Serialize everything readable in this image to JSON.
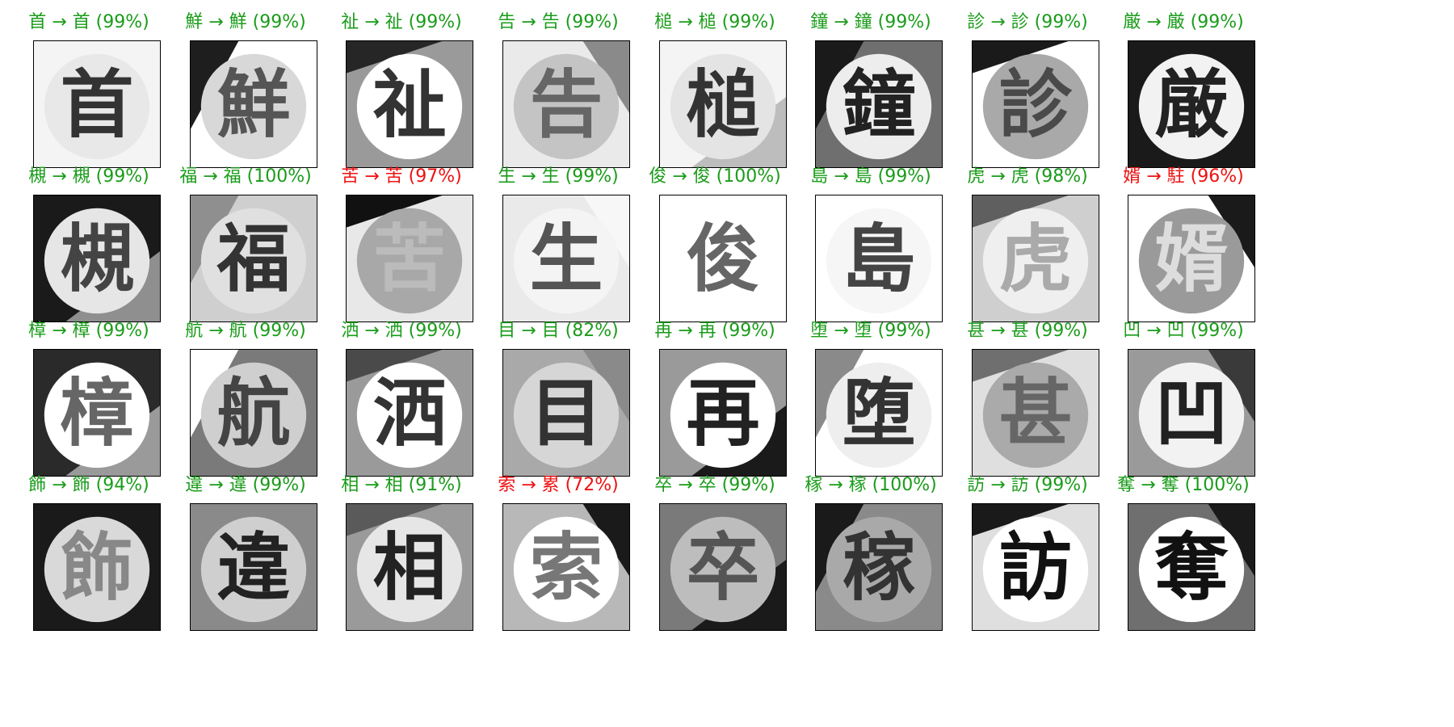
{
  "colors": {
    "correct": "#1a9c1a",
    "incorrect": "#ee1111",
    "border": "#000000"
  },
  "samples": [
    {
      "true": "首",
      "pred": "首",
      "conf": "99%",
      "correct": true,
      "shade": "#e8e8e8",
      "bg": [
        "#f4f4f4",
        "#f4f4f4"
      ],
      "ink": "#333333"
    },
    {
      "true": "鮮",
      "pred": "鮮",
      "conf": "99%",
      "correct": true,
      "shade": "#d8d8d8",
      "bg": [
        "#1e1e1e",
        "#ffffff"
      ],
      "ink": "#555555"
    },
    {
      "true": "祉",
      "pred": "祉",
      "conf": "99%",
      "correct": true,
      "shade": "#ffffff",
      "bg": [
        "#262626",
        "#9a9a9a"
      ],
      "ink": "#333333"
    },
    {
      "true": "告",
      "pred": "告",
      "conf": "99%",
      "correct": true,
      "shade": "#c4c4c4",
      "bg": [
        "#8a8a8a",
        "#eaeaea"
      ],
      "ink": "#666666"
    },
    {
      "true": "槌",
      "pred": "槌",
      "conf": "99%",
      "correct": true,
      "shade": "#e4e4e4",
      "bg": [
        "#bdbdbd",
        "#f4f4f4"
      ],
      "ink": "#333333"
    },
    {
      "true": "鐘",
      "pred": "鐘",
      "conf": "99%",
      "correct": true,
      "shade": "#ededed",
      "bg": [
        "#1a1a1a",
        "#6f6f6f"
      ],
      "ink": "#222222"
    },
    {
      "true": "診",
      "pred": "診",
      "conf": "99%",
      "correct": true,
      "shade": "#a9a9a9",
      "bg": [
        "#1a1a1a",
        "#ffffff"
      ],
      "ink": "#4a4a4a"
    },
    {
      "true": "厳",
      "pred": "厳",
      "conf": "99%",
      "correct": true,
      "shade": "#f2f2f2",
      "bg": [
        "#1a1a1a",
        "#1a1a1a"
      ],
      "ink": "#222222"
    },
    {
      "true": "槻",
      "pred": "槻",
      "conf": "99%",
      "correct": true,
      "shade": "#e6e6e6",
      "bg": [
        "#8f8f8f",
        "#1a1a1a"
      ],
      "ink": "#444444"
    },
    {
      "true": "福",
      "pred": "福",
      "conf": "100%",
      "correct": true,
      "shade": "#e0e0e0",
      "bg": [
        "#8f8f8f",
        "#cfcfcf"
      ],
      "ink": "#333333"
    },
    {
      "true": "苦",
      "pred": "苦",
      "conf": "97%",
      "correct": false,
      "shade": "#a8a8a8",
      "bg": [
        "#111111",
        "#e8e8e8"
      ],
      "ink": "#bbbbbb"
    },
    {
      "true": "生",
      "pred": "生",
      "conf": "99%",
      "correct": true,
      "shade": "#f4f4f4",
      "bg": [
        "#f7f7f7",
        "#eaeaea"
      ],
      "ink": "#555555"
    },
    {
      "true": "俊",
      "pred": "俊",
      "conf": "100%",
      "correct": true,
      "shade": "#ffffff",
      "bg": [
        "#ffffff",
        "#ffffff"
      ],
      "ink": "#666666"
    },
    {
      "true": "島",
      "pred": "島",
      "conf": "99%",
      "correct": true,
      "shade": "#f6f6f6",
      "bg": [
        "#ffffff",
        "#ffffff"
      ],
      "ink": "#444444"
    },
    {
      "true": "虎",
      "pred": "虎",
      "conf": "98%",
      "correct": true,
      "shade": "#efefef",
      "bg": [
        "#5f5f5f",
        "#cfcfcf"
      ],
      "ink": "#aaaaaa"
    },
    {
      "true": "婿",
      "pred": "駐",
      "conf": "96%",
      "correct": false,
      "shade": "#9a9a9a",
      "bg": [
        "#1a1a1a",
        "#ffffff"
      ],
      "ink": "#dddddd"
    },
    {
      "true": "樟",
      "pred": "樟",
      "conf": "99%",
      "correct": true,
      "shade": "#ffffff",
      "bg": [
        "#9a9a9a",
        "#2a2a2a"
      ],
      "ink": "#666666"
    },
    {
      "true": "航",
      "pred": "航",
      "conf": "99%",
      "correct": true,
      "shade": "#cfcfcf",
      "bg": [
        "#ffffff",
        "#7a7a7a"
      ],
      "ink": "#444444"
    },
    {
      "true": "洒",
      "pred": "洒",
      "conf": "99%",
      "correct": true,
      "shade": "#ffffff",
      "bg": [
        "#4a4a4a",
        "#9a9a9a"
      ],
      "ink": "#333333"
    },
    {
      "true": "目",
      "pred": "目",
      "conf": "82%",
      "correct": true,
      "shade": "#d6d6d6",
      "bg": [
        "#8a8a8a",
        "#a9a9a9"
      ],
      "ink": "#333333"
    },
    {
      "true": "再",
      "pred": "再",
      "conf": "99%",
      "correct": true,
      "shade": "#ffffff",
      "bg": [
        "#1a1a1a",
        "#9a9a9a"
      ],
      "ink": "#222222"
    },
    {
      "true": "堕",
      "pred": "堕",
      "conf": "99%",
      "correct": true,
      "shade": "#eeeeee",
      "bg": [
        "#8a8a8a",
        "#ffffff"
      ],
      "ink": "#333333"
    },
    {
      "true": "甚",
      "pred": "甚",
      "conf": "99%",
      "correct": true,
      "shade": "#aaaaaa",
      "bg": [
        "#6f6f6f",
        "#dfdfdf"
      ],
      "ink": "#666666"
    },
    {
      "true": "凹",
      "pred": "凹",
      "conf": "99%",
      "correct": true,
      "shade": "#f2f2f2",
      "bg": [
        "#3a3a3a",
        "#9a9a9a"
      ],
      "ink": "#222222"
    },
    {
      "true": "飾",
      "pred": "飾",
      "conf": "94%",
      "correct": true,
      "shade": "#d9d9d9",
      "bg": [
        "#1a1a1a",
        "#1a1a1a"
      ],
      "ink": "#888888"
    },
    {
      "true": "違",
      "pred": "違",
      "conf": "99%",
      "correct": true,
      "shade": "#cfcfcf",
      "bg": [
        "#8a8a8a",
        "#8a8a8a"
      ],
      "ink": "#222222"
    },
    {
      "true": "相",
      "pred": "相",
      "conf": "91%",
      "correct": true,
      "shade": "#e6e6e6",
      "bg": [
        "#5a5a5a",
        "#9a9a9a"
      ],
      "ink": "#222222"
    },
    {
      "true": "索",
      "pred": "累",
      "conf": "72%",
      "correct": false,
      "shade": "#ffffff",
      "bg": [
        "#1a1a1a",
        "#b8b8b8"
      ],
      "ink": "#777777"
    },
    {
      "true": "卒",
      "pred": "卒",
      "conf": "99%",
      "correct": true,
      "shade": "#bdbdbd",
      "bg": [
        "#1a1a1a",
        "#7a7a7a"
      ],
      "ink": "#555555"
    },
    {
      "true": "稼",
      "pred": "稼",
      "conf": "100%",
      "correct": true,
      "shade": "#a9a9a9",
      "bg": [
        "#1a1a1a",
        "#8a8a8a"
      ],
      "ink": "#333333"
    },
    {
      "true": "訪",
      "pred": "訪",
      "conf": "99%",
      "correct": true,
      "shade": "#ffffff",
      "bg": [
        "#1a1a1a",
        "#dfdfdf"
      ],
      "ink": "#111111"
    },
    {
      "true": "奪",
      "pred": "奪",
      "conf": "100%",
      "correct": true,
      "shade": "#ffffff",
      "bg": [
        "#1a1a1a",
        "#6f6f6f"
      ],
      "ink": "#111111"
    }
  ]
}
